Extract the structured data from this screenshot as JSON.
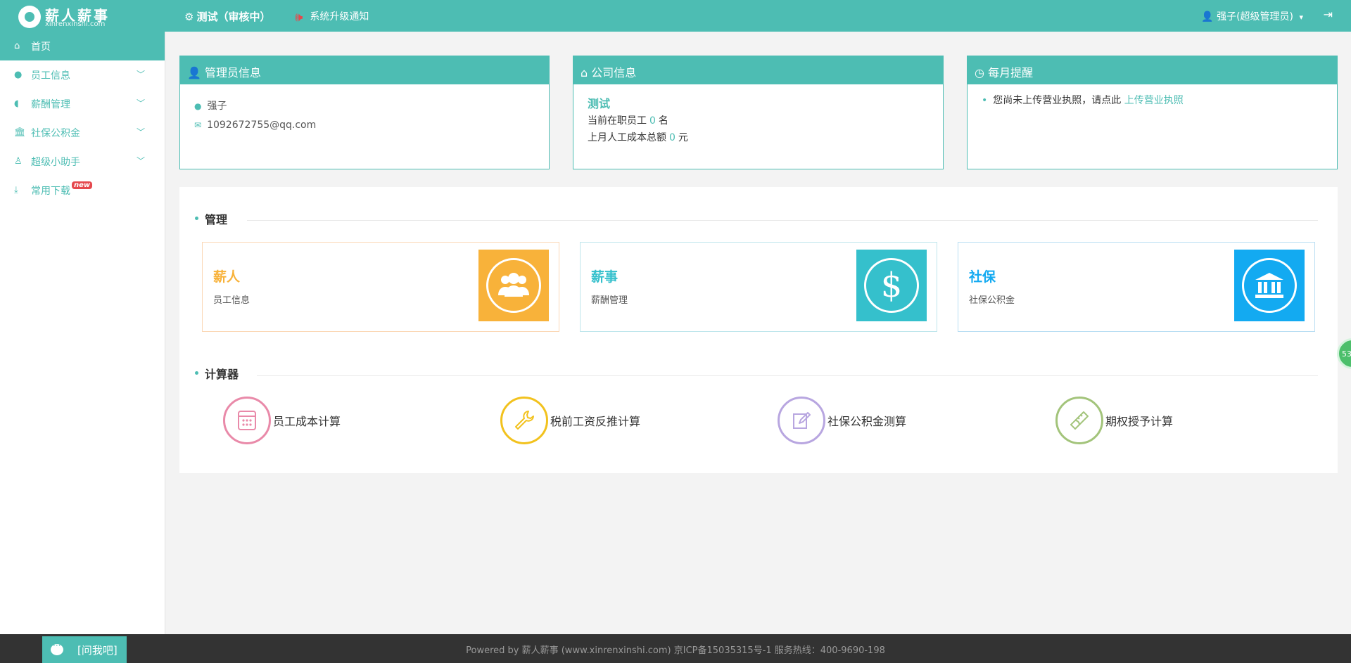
{
  "header": {
    "logo_name": "薪人薪事",
    "logo_sub": "xinrenxinshi.com",
    "company": "测试（审核中）",
    "notice": "系统升级通知",
    "user": "强子(超级管理员)"
  },
  "sidebar": {
    "items": [
      {
        "label": "首页",
        "icon": "home-icon"
      },
      {
        "label": "员工信息",
        "icon": "user-icon"
      },
      {
        "label": "薪酬管理",
        "icon": "signal-icon"
      },
      {
        "label": "社保公积金",
        "icon": "bank-icon"
      },
      {
        "label": "超级小助手",
        "icon": "helper-icon"
      },
      {
        "label": "常用下载",
        "icon": "download-icon",
        "badge": "new"
      }
    ]
  },
  "admin_card": {
    "title": "管理员信息",
    "name": "强子",
    "email": "1092672755@qq.com"
  },
  "company_card": {
    "title": "公司信息",
    "company_name": "测试",
    "staff_prefix": "当前在职员工",
    "staff_count": "0",
    "staff_suffix": "名",
    "cost_prefix": "上月人工成本总额",
    "cost_value": "0",
    "cost_suffix": "元"
  },
  "remind_card": {
    "title": "每月提醒",
    "text": "您尚未上传营业执照，请点此",
    "link": "上传营业执照"
  },
  "manage": {
    "title": "管理",
    "modules": [
      {
        "title": "薪人",
        "sub": "员工信息",
        "color": "#f8b23a",
        "icon": "people-icon"
      },
      {
        "title": "薪事",
        "sub": "薪酬管理",
        "color": "#35c0cc",
        "icon": "dollar-icon"
      },
      {
        "title": "社保",
        "sub": "社保公积金",
        "color": "#13aaf1",
        "icon": "bank-icon"
      }
    ]
  },
  "calculator": {
    "title": "计算器",
    "items": [
      {
        "label": "员工成本计算",
        "color": "#e98aa9",
        "icon": "calculator-icon"
      },
      {
        "label": "税前工资反推计算",
        "color": "#f2c21e",
        "icon": "wrench-icon"
      },
      {
        "label": "社保公积金测算",
        "color": "#b8a6e0",
        "icon": "edit-icon"
      },
      {
        "label": "期权授予计算",
        "color": "#a3c47b",
        "icon": "protractor-icon"
      }
    ]
  },
  "float_badge": "53",
  "footer": {
    "ask": "[问我吧]",
    "text": "Powered by 薪人薪事 (www.xinrenxinshi.com)    京ICP备15035315号-1    服务热线：400-9690-198"
  }
}
